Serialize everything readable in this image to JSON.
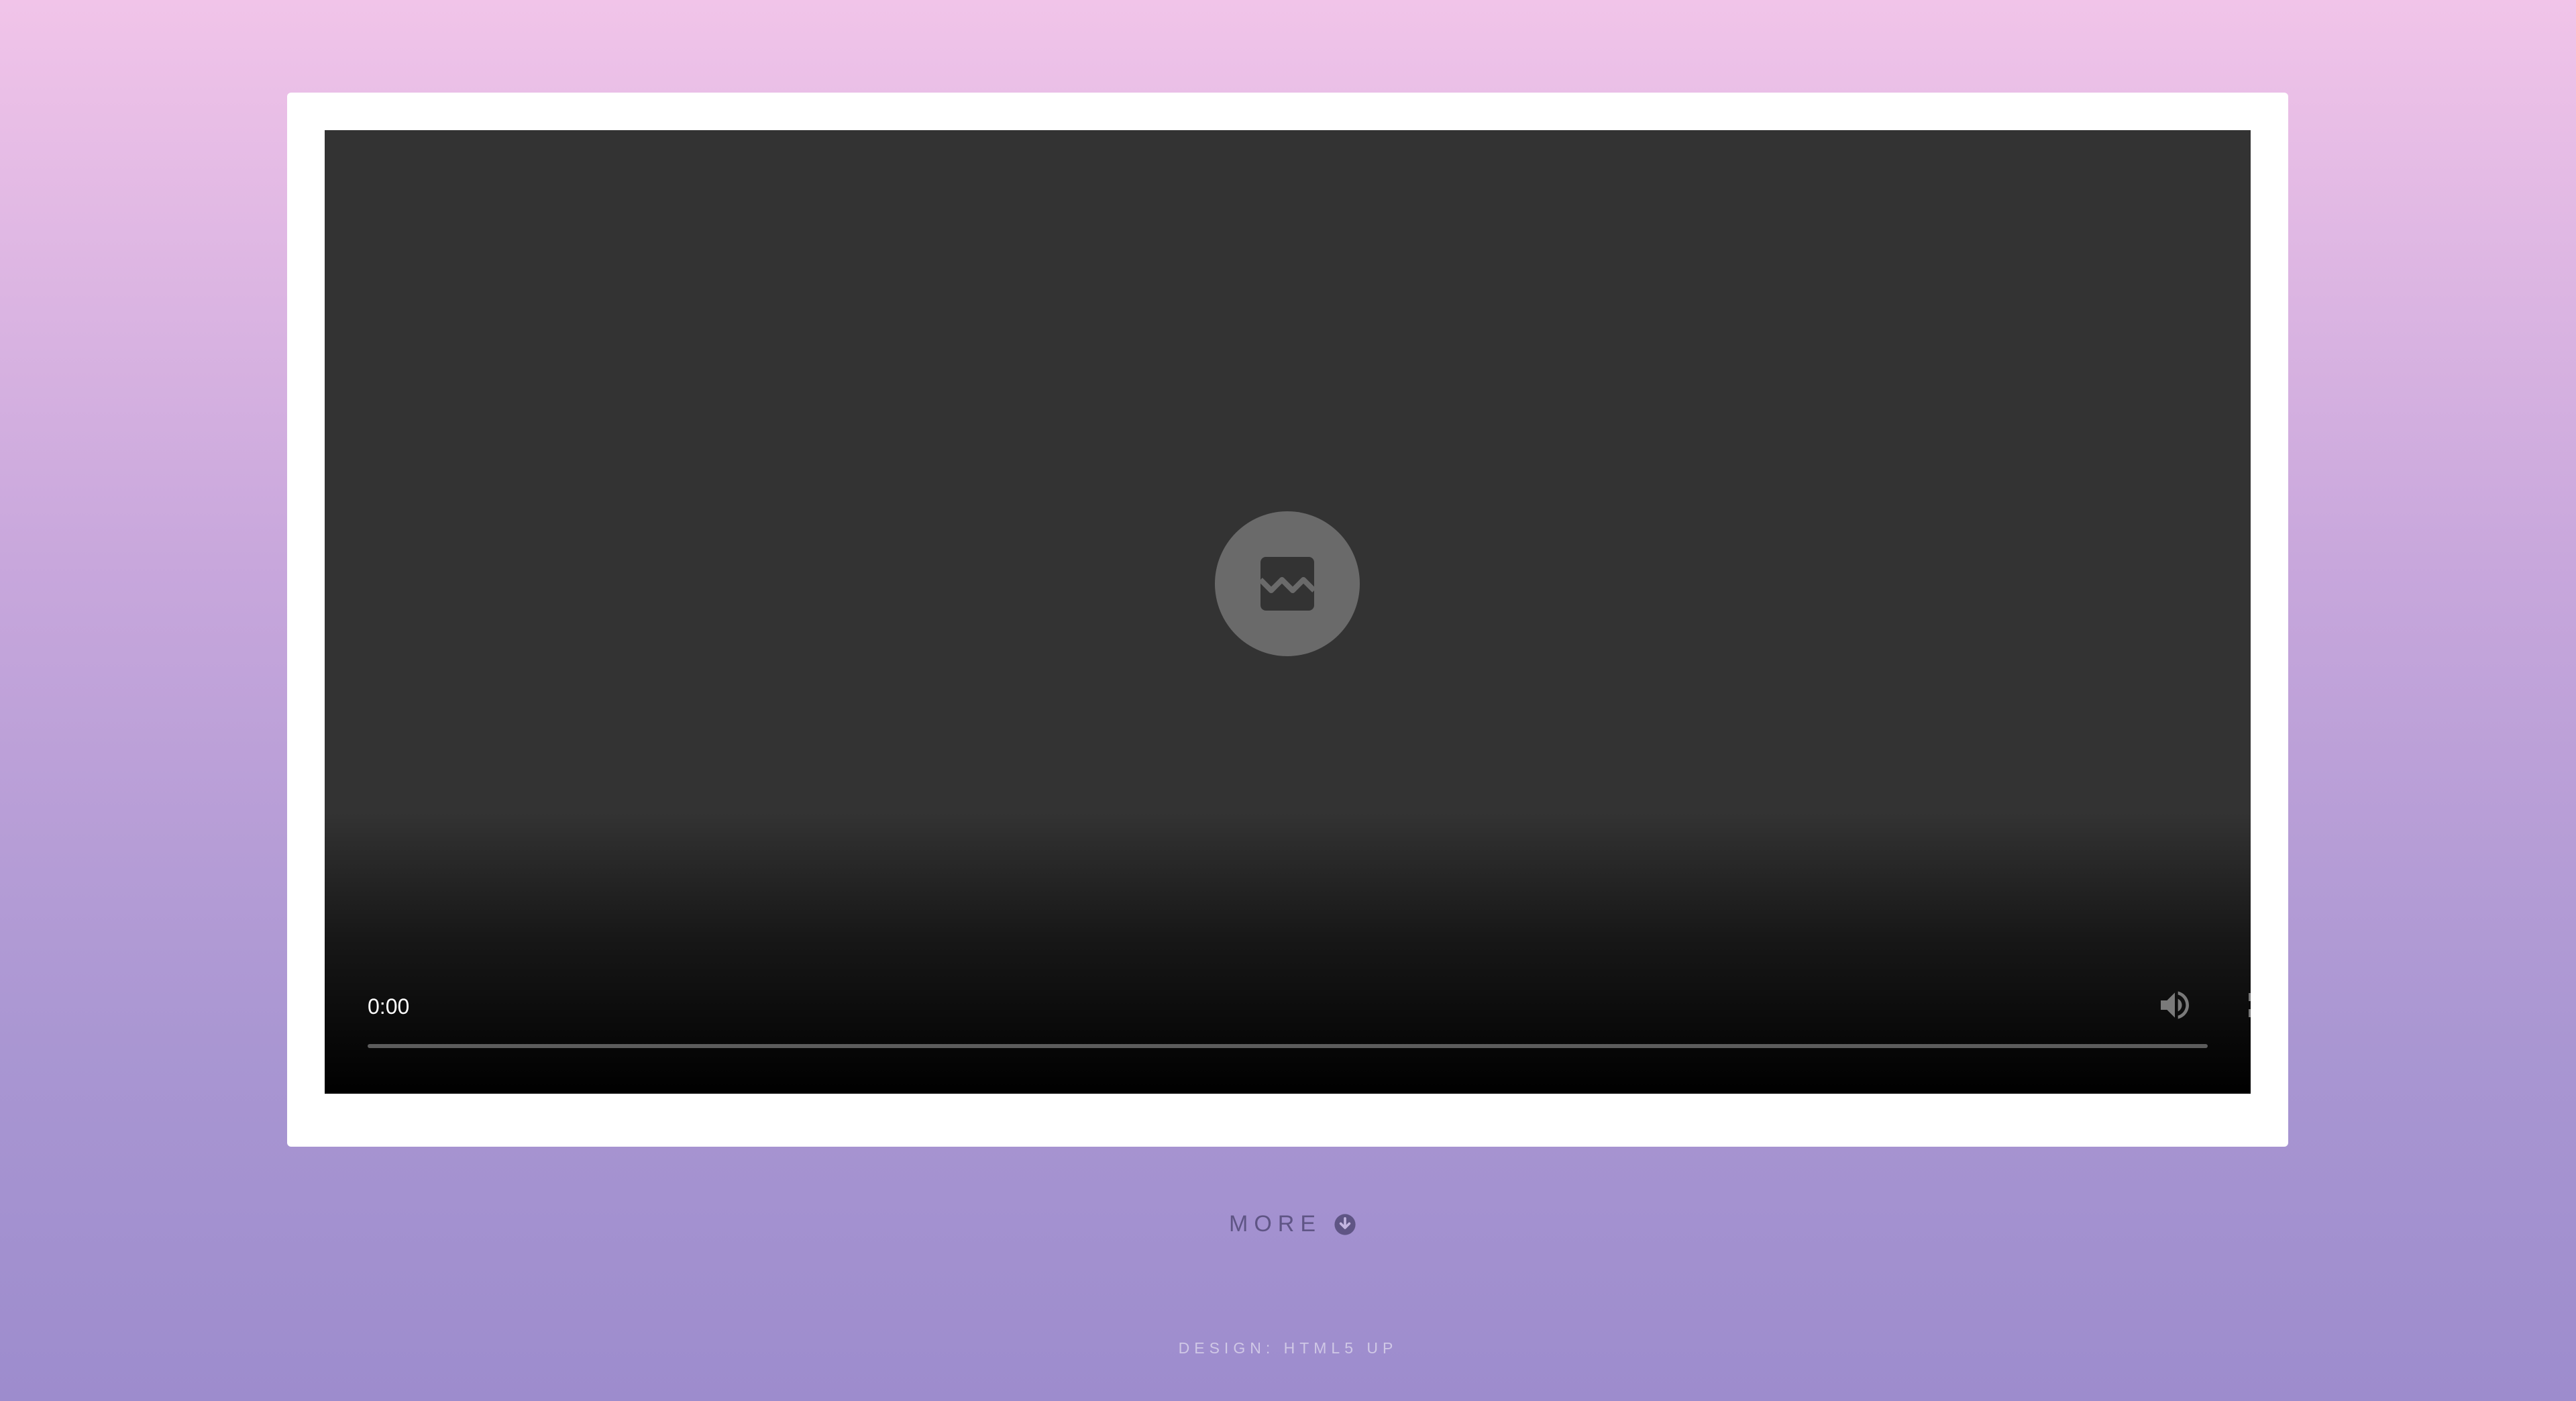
{
  "player": {
    "current_time": "0:00",
    "progress": 0,
    "state": "error",
    "status_icon": "broken-image-icon",
    "controls": {
      "mute_icon": "volume-icon",
      "fullscreen_icon": "fullscreen-icon",
      "more_icon": "more-vert-icon"
    }
  },
  "more": {
    "label": "MORE",
    "icon": "arrow-down-circle-icon"
  },
  "footer": {
    "credit": "DESIGN: HTML5 UP"
  },
  "colors": {
    "background_top": "#f1c4e9",
    "background_bottom": "#9d8ccd",
    "frame": "#ffffff",
    "video_bg": "#333333",
    "more_text": "#5f5585",
    "footer_text": "#d0c8e6"
  }
}
